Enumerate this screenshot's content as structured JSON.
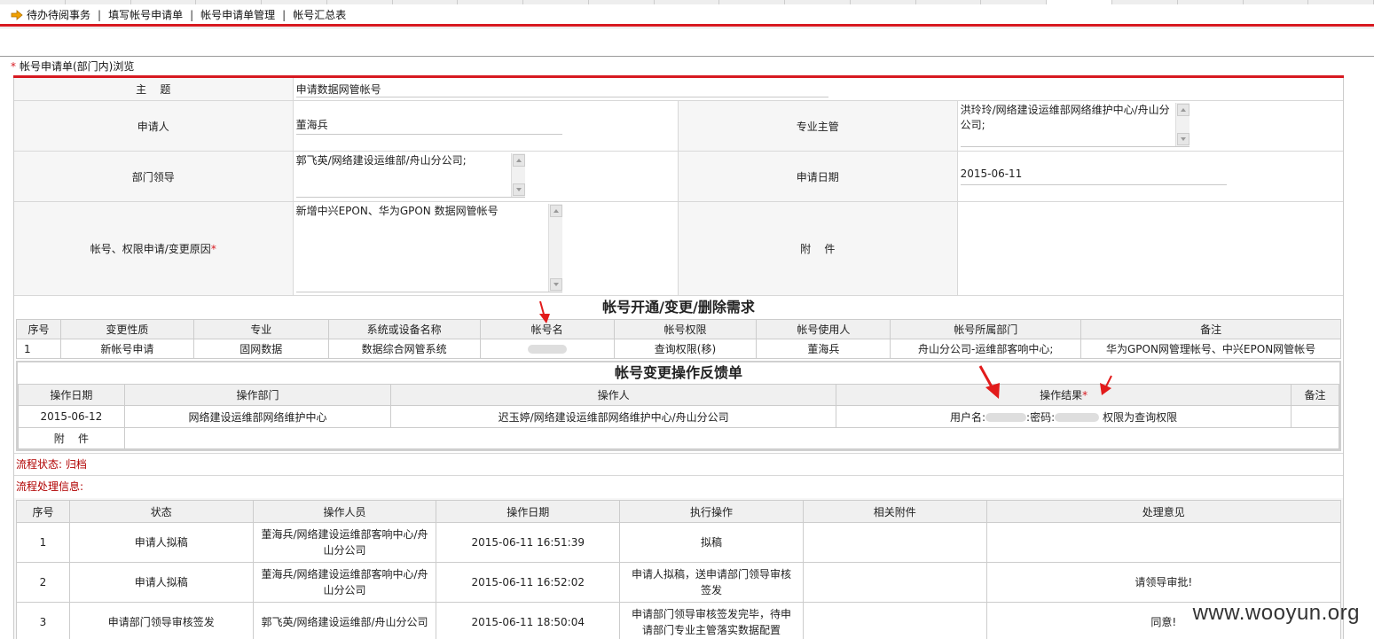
{
  "nav": {
    "items": [
      "待办待阅事务",
      "填写帐号申请单",
      "帐号申请单管理",
      "帐号汇总表"
    ],
    "separator": "|"
  },
  "page_heading": "帐号申请单(部门内)浏览",
  "form": {
    "subject_label": "主    题",
    "subject_value": "申请数据网管帐号",
    "applicant_label": "申请人",
    "applicant_value": "董海兵",
    "supervisor_label": "专业主管",
    "supervisor_value": "洪玲玲/网络建设运维部网络维护中心/舟山分公司;",
    "dept_leader_label": "部门领导",
    "dept_leader_value": "郭飞英/网络建设运维部/舟山分公司;",
    "apply_date_label": "申请日期",
    "apply_date_value": "2015-06-11",
    "reason_label": "帐号、权限申请/变更原因",
    "reason_value": "新增中兴EPON、华为GPON 数据网管帐号",
    "attachment_label": "附    件"
  },
  "request": {
    "title": "帐号开通/变更/删除需求",
    "headers": [
      "序号",
      "变更性质",
      "专业",
      "系统或设备名称",
      "帐号名",
      "帐号权限",
      "帐号使用人",
      "帐号所属部门",
      "备注"
    ],
    "row": [
      "1",
      "新帐号申请",
      "固网数据",
      "数据综合网管系统",
      "",
      "查询权限(移)",
      "董海兵",
      "舟山分公司-运维部客响中心;",
      "华为GPON网管理帐号、中兴EPON网管帐号"
    ]
  },
  "feedback": {
    "title": "帐号变更操作反馈单",
    "headers": [
      "操作日期",
      "操作部门",
      "操作人",
      "操作结果",
      "备注"
    ],
    "row": {
      "date": "2015-06-12",
      "dept": "网络建设运维部网络维护中心",
      "operator": "迟玉婷/网络建设运维部网络维护中心/舟山分公司",
      "result_user": "用户名:",
      "result_pwd": ":密码:",
      "result_tail": "权限为查询权限",
      "remark": ""
    },
    "attachment_label": "附    件"
  },
  "flow_status": "流程状态: 归档",
  "flow_info_label": "流程处理信息:",
  "flow": {
    "headers": [
      "序号",
      "状态",
      "操作人员",
      "操作日期",
      "执行操作",
      "相关附件",
      "处理意见"
    ],
    "rows": [
      {
        "no": "1",
        "state": "申请人拟稿",
        "person": "董海兵/网络建设运维部客响中心/舟山分公司",
        "date": "2015-06-11 16:51:39",
        "action": "拟稿",
        "attach": "",
        "opinion": ""
      },
      {
        "no": "2",
        "state": "申请人拟稿",
        "person": "董海兵/网络建设运维部客响中心/舟山分公司",
        "date": "2015-06-11 16:52:02",
        "action": "申请人拟稿，送申请部门领导审核签发",
        "attach": "",
        "opinion": "请领导审批!"
      },
      {
        "no": "3",
        "state": "申请部门领导审核签发",
        "person": "郭飞英/网络建设运维部/舟山分公司",
        "date": "2015-06-11 18:50:04",
        "action": "申请部门领导审核签发完毕，待申请部门专业主管落实数据配置",
        "attach": "",
        "opinion": "同意!"
      }
    ]
  },
  "watermark": "www.wooyun.org",
  "colors": {
    "accent_red": "#d71920",
    "status_red": "#b00000",
    "annotation_red": "#e21b1b"
  }
}
